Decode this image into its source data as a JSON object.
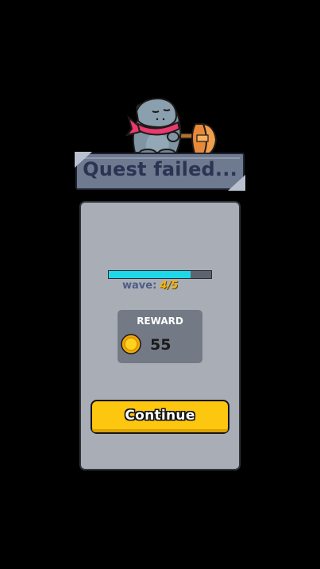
{
  "banner": {
    "title": "Quest failed..."
  },
  "mascot": {
    "icon": "hippo-warrior-with-axe-icon"
  },
  "progress": {
    "wave_label": "wave:",
    "wave_value": "4/5",
    "fraction": 0.8,
    "fill_color": "#1ed8ea"
  },
  "reward": {
    "title": "REWARD",
    "icon": "gold-coin-icon",
    "amount": "55"
  },
  "actions": {
    "continue_label": "Continue",
    "continue_color": "#fdc60f"
  }
}
